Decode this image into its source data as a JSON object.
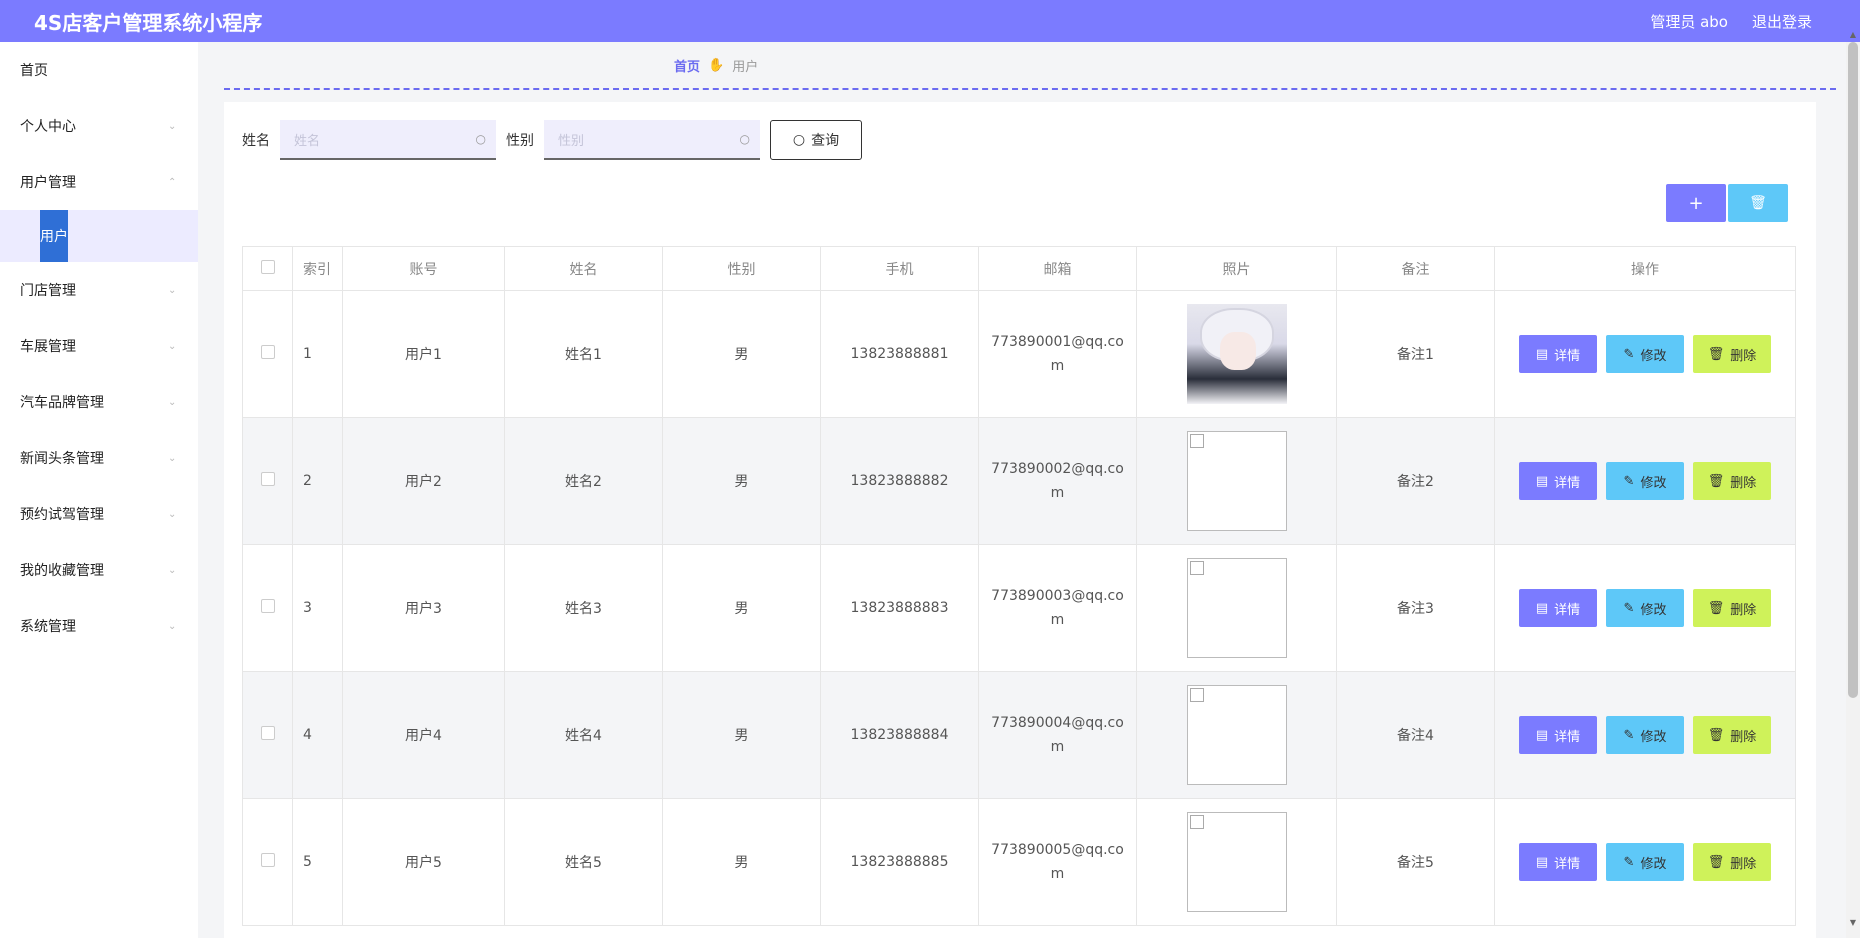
{
  "app": {
    "title": "4S店客户管理系统小程序",
    "user_label": "管理员 abo",
    "logout_label": "退出登录"
  },
  "sidebar": {
    "items": [
      {
        "label": "首页",
        "has_chevron": false
      },
      {
        "label": "个人中心",
        "has_chevron": true
      },
      {
        "label": "用户管理",
        "has_chevron": true,
        "expanded": true
      },
      {
        "label": "门店管理",
        "has_chevron": true
      },
      {
        "label": "车展管理",
        "has_chevron": true
      },
      {
        "label": "汽车品牌管理",
        "has_chevron": true
      },
      {
        "label": "新闻头条管理",
        "has_chevron": true
      },
      {
        "label": "预约试驾管理",
        "has_chevron": true
      },
      {
        "label": "我的收藏管理",
        "has_chevron": true
      },
      {
        "label": "系统管理",
        "has_chevron": true
      }
    ],
    "active_sub": "用户"
  },
  "breadcrumb": {
    "home": "首页",
    "current": "用户"
  },
  "search": {
    "name_label": "姓名",
    "name_placeholder": "姓名",
    "gender_label": "性别",
    "gender_placeholder": "性别",
    "query_label": "查询"
  },
  "table": {
    "headers": [
      "索引",
      "账号",
      "姓名",
      "性别",
      "手机",
      "邮箱",
      "照片",
      "备注",
      "操作"
    ],
    "rows": [
      {
        "index": "1",
        "account": "用户1",
        "name": "姓名1",
        "gender": "男",
        "phone": "13823888881",
        "email_a": "773890001@qq.co",
        "email_b": "m",
        "note": "备注1",
        "photo": "portrait"
      },
      {
        "index": "2",
        "account": "用户2",
        "name": "姓名2",
        "gender": "男",
        "phone": "13823888882",
        "email_a": "773890002@qq.co",
        "email_b": "m",
        "note": "备注2",
        "photo": "broken"
      },
      {
        "index": "3",
        "account": "用户3",
        "name": "姓名3",
        "gender": "男",
        "phone": "13823888883",
        "email_a": "773890003@qq.co",
        "email_b": "m",
        "note": "备注3",
        "photo": "broken"
      },
      {
        "index": "4",
        "account": "用户4",
        "name": "姓名4",
        "gender": "男",
        "phone": "13823888884",
        "email_a": "773890004@qq.co",
        "email_b": "m",
        "note": "备注4",
        "photo": "broken"
      },
      {
        "index": "5",
        "account": "用户5",
        "name": "姓名5",
        "gender": "男",
        "phone": "13823888885",
        "email_a": "773890005@qq.co",
        "email_b": "m",
        "note": "备注5",
        "photo": "broken"
      }
    ],
    "ops": {
      "detail": "详情",
      "edit": "修改",
      "delete": "删除"
    }
  },
  "colors": {
    "topbar": "#7b7bff",
    "detail_btn": "#7b7bff",
    "edit_btn": "#5ec8f8",
    "delete_btn": "#cff25a",
    "active_sub": "#2f6fd6"
  }
}
